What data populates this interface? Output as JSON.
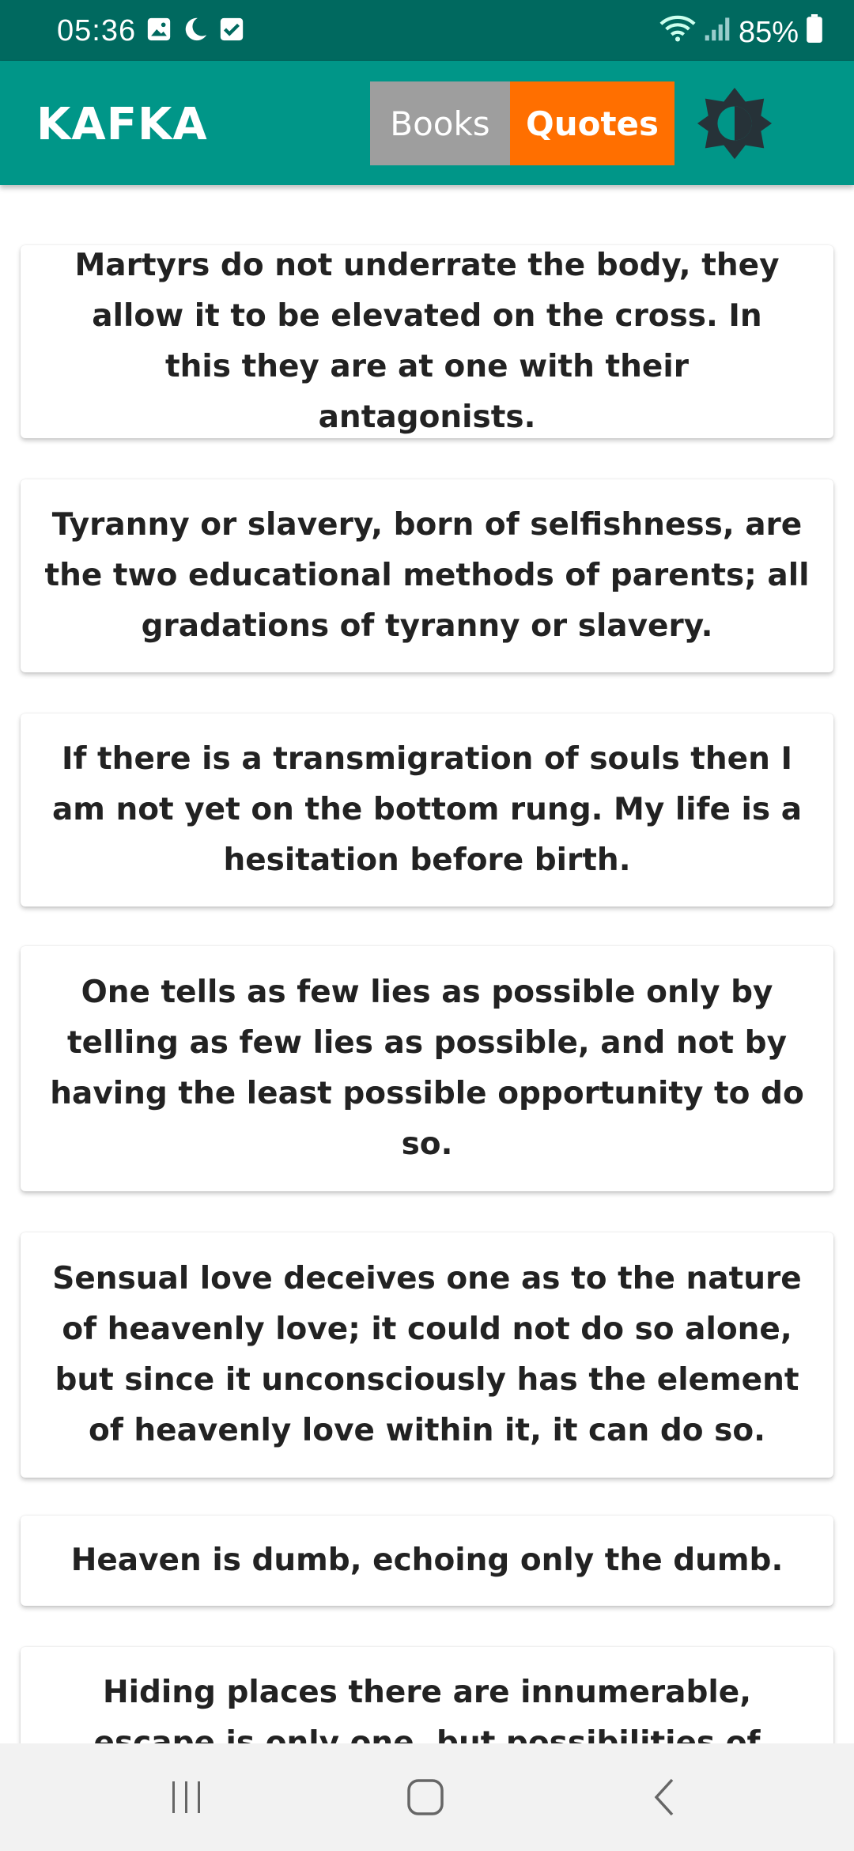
{
  "status_bar": {
    "time": "05:36",
    "battery_percent": "85%",
    "icons_left": [
      "image-icon",
      "moon-icon",
      "check-box-icon"
    ],
    "icons_right": [
      "wifi-icon",
      "signal-icon",
      "battery-icon"
    ]
  },
  "app_bar": {
    "title": "KAFKA",
    "tabs": [
      {
        "label": "Books",
        "selected": false
      },
      {
        "label": "Quotes",
        "selected": true
      }
    ],
    "theme_toggle_icon": "brightness-icon"
  },
  "colors": {
    "status_bar": "#00695f",
    "app_bar": "#009688",
    "tab_inactive": "#9e9e9e",
    "tab_active": "#ff6f00",
    "card_text": "#222222"
  },
  "quotes": [
    "Martyrs do not underrate the body, they allow it to be elevated on the cross. In this they are at one with their antagonists.",
    "Tyranny or slavery, born of selfishness, are the two educational methods of parents; all gradations of tyranny or slavery.",
    "If there is a transmigration of souls then I am not yet on the bottom rung. My life is a hesitation before birth.",
    "One tells as few lies as possible only by telling as few lies as possible, and not by having the least possible opportunity to do so.",
    "Sensual love deceives one as to the nature of heavenly love; it could not do so alone, but since it unconsciously has the element of heavenly love within it, it can do so.",
    "Heaven is dumb, echoing only the dumb.",
    "Hiding places there are innumerable, escape is only one, but possibilities of escape, again"
  ],
  "nav_bar": {
    "buttons": [
      "recent-apps-icon",
      "home-icon",
      "back-icon"
    ]
  }
}
